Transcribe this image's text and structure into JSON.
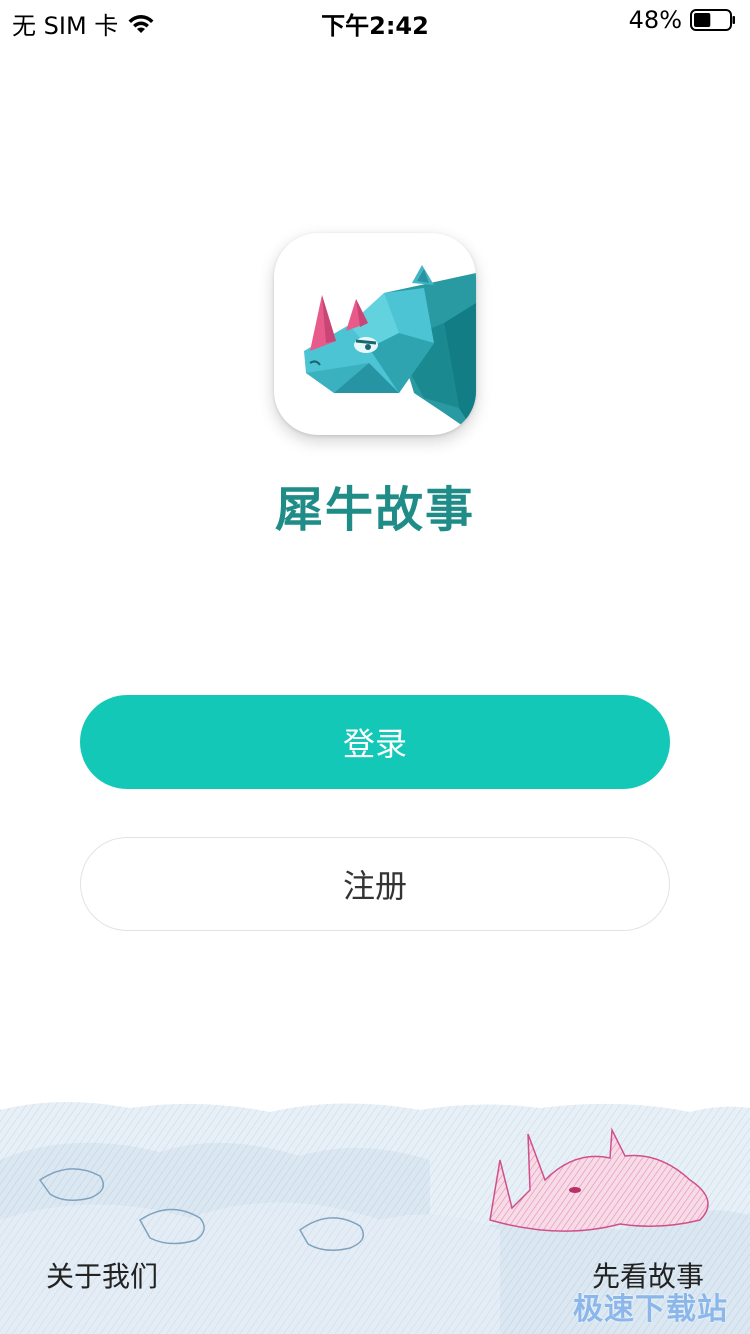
{
  "status_bar": {
    "carrier": "无 SIM 卡",
    "time": "下午2:42",
    "battery": "48%",
    "battery_level": 0.48
  },
  "app": {
    "name": "犀牛故事",
    "brand_color": "#1f8c88"
  },
  "buttons": {
    "login_label": "登录",
    "register_label": "注册",
    "login_color": "#14c8b8"
  },
  "footer": {
    "about_label": "关于我们",
    "preview_label": "先看故事",
    "watermark": "极速下载站"
  }
}
